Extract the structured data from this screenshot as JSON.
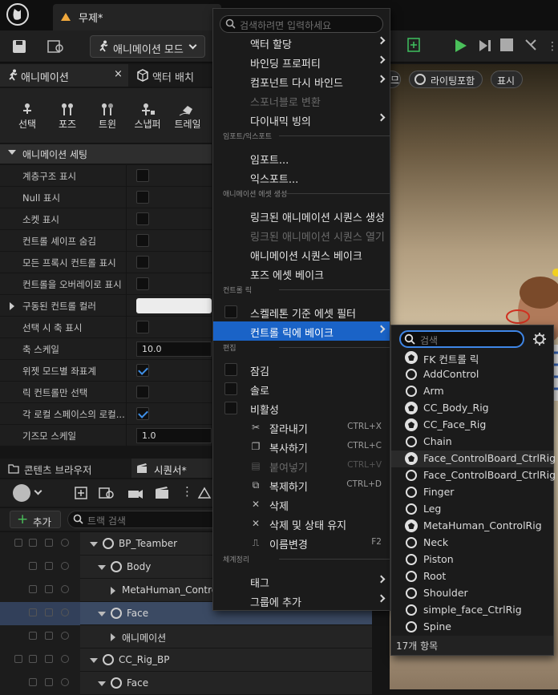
{
  "document_tab": {
    "title": "무제*"
  },
  "toolbar": {
    "mode_label": "애니메이션 모드"
  },
  "left_panel": {
    "tabs": [
      {
        "label": "애니메이션"
      },
      {
        "label": "액터 배치"
      }
    ],
    "tools": [
      {
        "label": "선택"
      },
      {
        "label": "포즈"
      },
      {
        "label": "트윈"
      },
      {
        "label": "스냅퍼"
      },
      {
        "label": "트레일"
      }
    ],
    "section_title": "애니메이션 세팅",
    "properties": [
      {
        "label": "계층구조 표시",
        "type": "check",
        "checked": false
      },
      {
        "label": "Null 표시",
        "type": "check",
        "checked": false
      },
      {
        "label": "소켓 표시",
        "type": "check",
        "checked": false
      },
      {
        "label": "컨트롤 셰이프 숨김",
        "type": "check",
        "checked": false
      },
      {
        "label": "모든 프록시 컨트롤 표시",
        "type": "check",
        "checked": false
      },
      {
        "label": "컨트롤을 오버레이로 표시",
        "type": "check",
        "checked": false
      },
      {
        "label": "구동된 컨트롤 컬러",
        "type": "color",
        "value": "#ececec"
      },
      {
        "label": "선택 시 축 표시",
        "type": "check",
        "checked": false
      },
      {
        "label": "축 스케일",
        "type": "number",
        "value": "10.0"
      },
      {
        "label": "위젯 모드별 좌표계",
        "type": "check",
        "checked": true
      },
      {
        "label": "릭 컨트롤만 선택",
        "type": "check",
        "checked": false
      },
      {
        "label": "각 로컬 스페이스의 로컬...",
        "type": "check",
        "checked": true
      },
      {
        "label": "기즈모 스케일",
        "type": "number",
        "value": "1.0"
      }
    ]
  },
  "bottom_panel": {
    "tabs": [
      {
        "label": "콘텐츠 브라우저"
      },
      {
        "label": "시퀀서*"
      }
    ],
    "add_label": "추가",
    "track_search_placeholder": "트랙 검색",
    "tracks": [
      {
        "label": "BP_Teamber",
        "indent": 0
      },
      {
        "label": "Body",
        "indent": 1
      },
      {
        "label": "MetaHuman_Control",
        "indent": 2
      },
      {
        "label": "Face",
        "indent": 1,
        "selected": true
      },
      {
        "label": "애니메이션",
        "indent": 2
      },
      {
        "label": "CC_Rig_BP",
        "indent": 0
      },
      {
        "label": "Face",
        "indent": 1
      }
    ]
  },
  "viewport": {
    "lighting_label": "라이팅포함",
    "show_label": "표시",
    "partial_left_label": "므"
  },
  "context_menu": {
    "search_placeholder": "검색하려면 입력하세요",
    "items": [
      {
        "label": "액터 할당",
        "arrow": true
      },
      {
        "label": "바인딩 프로퍼티",
        "arrow": true
      },
      {
        "label": "컴포넌트 다시 바인드",
        "arrow": true
      },
      {
        "label": "스포너블로 변환",
        "disabled": true
      },
      {
        "label": "다이내믹 빙의",
        "arrow": true
      },
      {
        "section": "임포트/익스포트"
      },
      {
        "label": "임포트..."
      },
      {
        "label": "익스포트..."
      },
      {
        "section": "애니메이션 에셋 생성"
      },
      {
        "label": "링크된 애니메이션 시퀀스 생성"
      },
      {
        "label": "링크된 애니메이션 시퀀스 열기",
        "disabled": true
      },
      {
        "label": "애니메이션 시퀀스 베이크"
      },
      {
        "label": "포즈 에셋 베이크"
      },
      {
        "section": "컨트롤 릭"
      },
      {
        "label": "스켈레톤 기준 에셋 필터",
        "checkbox": true
      },
      {
        "label": "컨트롤 릭에 베이크",
        "arrow": true,
        "highlighted": true
      },
      {
        "section": "편집"
      },
      {
        "label": "잠김",
        "checkbox": true
      },
      {
        "label": "솔로",
        "checkbox": true
      },
      {
        "label": "비활성",
        "checkbox": true
      },
      {
        "label": "잘라내기",
        "icon": "cut-icon",
        "shortcut": "CTRL+X"
      },
      {
        "label": "복사하기",
        "icon": "copy-icon",
        "shortcut": "CTRL+C"
      },
      {
        "label": "붙여넣기",
        "icon": "paste-icon",
        "shortcut": "CTRL+V",
        "disabled": true
      },
      {
        "label": "복제하기",
        "icon": "duplicate-icon",
        "shortcut": "CTRL+D"
      },
      {
        "label": "삭제",
        "icon": "delete-icon"
      },
      {
        "label": "삭제 및 상태 유지",
        "icon": "delete-icon"
      },
      {
        "label": "이름변경",
        "icon": "rename-icon",
        "shortcut": "F2"
      },
      {
        "section": "체계정리"
      },
      {
        "label": "태그",
        "arrow": true
      },
      {
        "label": "그룹에 추가",
        "arrow": true
      }
    ]
  },
  "submenu": {
    "search_placeholder": "검색",
    "items": [
      {
        "label": "FK 컨트롤 릭",
        "icon": "rig"
      },
      {
        "label": "AddControl",
        "icon": "circle"
      },
      {
        "label": "Arm",
        "icon": "circle"
      },
      {
        "label": "CC_Body_Rig",
        "icon": "rig"
      },
      {
        "label": "CC_Face_Rig",
        "icon": "rig"
      },
      {
        "label": "Chain",
        "icon": "circle"
      },
      {
        "label": "Face_ControlBoard_CtrlRig",
        "icon": "rig",
        "hover": true
      },
      {
        "label": "Face_ControlBoard_CtrlRig",
        "icon": "circle"
      },
      {
        "label": "Finger",
        "icon": "circle"
      },
      {
        "label": "Leg",
        "icon": "circle"
      },
      {
        "label": "MetaHuman_ControlRig",
        "icon": "rig"
      },
      {
        "label": "Neck",
        "icon": "circle"
      },
      {
        "label": "Piston",
        "icon": "circle"
      },
      {
        "label": "Root",
        "icon": "circle"
      },
      {
        "label": "Shoulder",
        "icon": "circle"
      },
      {
        "label": "simple_face_CtrlRig",
        "icon": "circle"
      },
      {
        "label": "Spine",
        "icon": "circle"
      }
    ],
    "count_label": "17개 항목"
  }
}
